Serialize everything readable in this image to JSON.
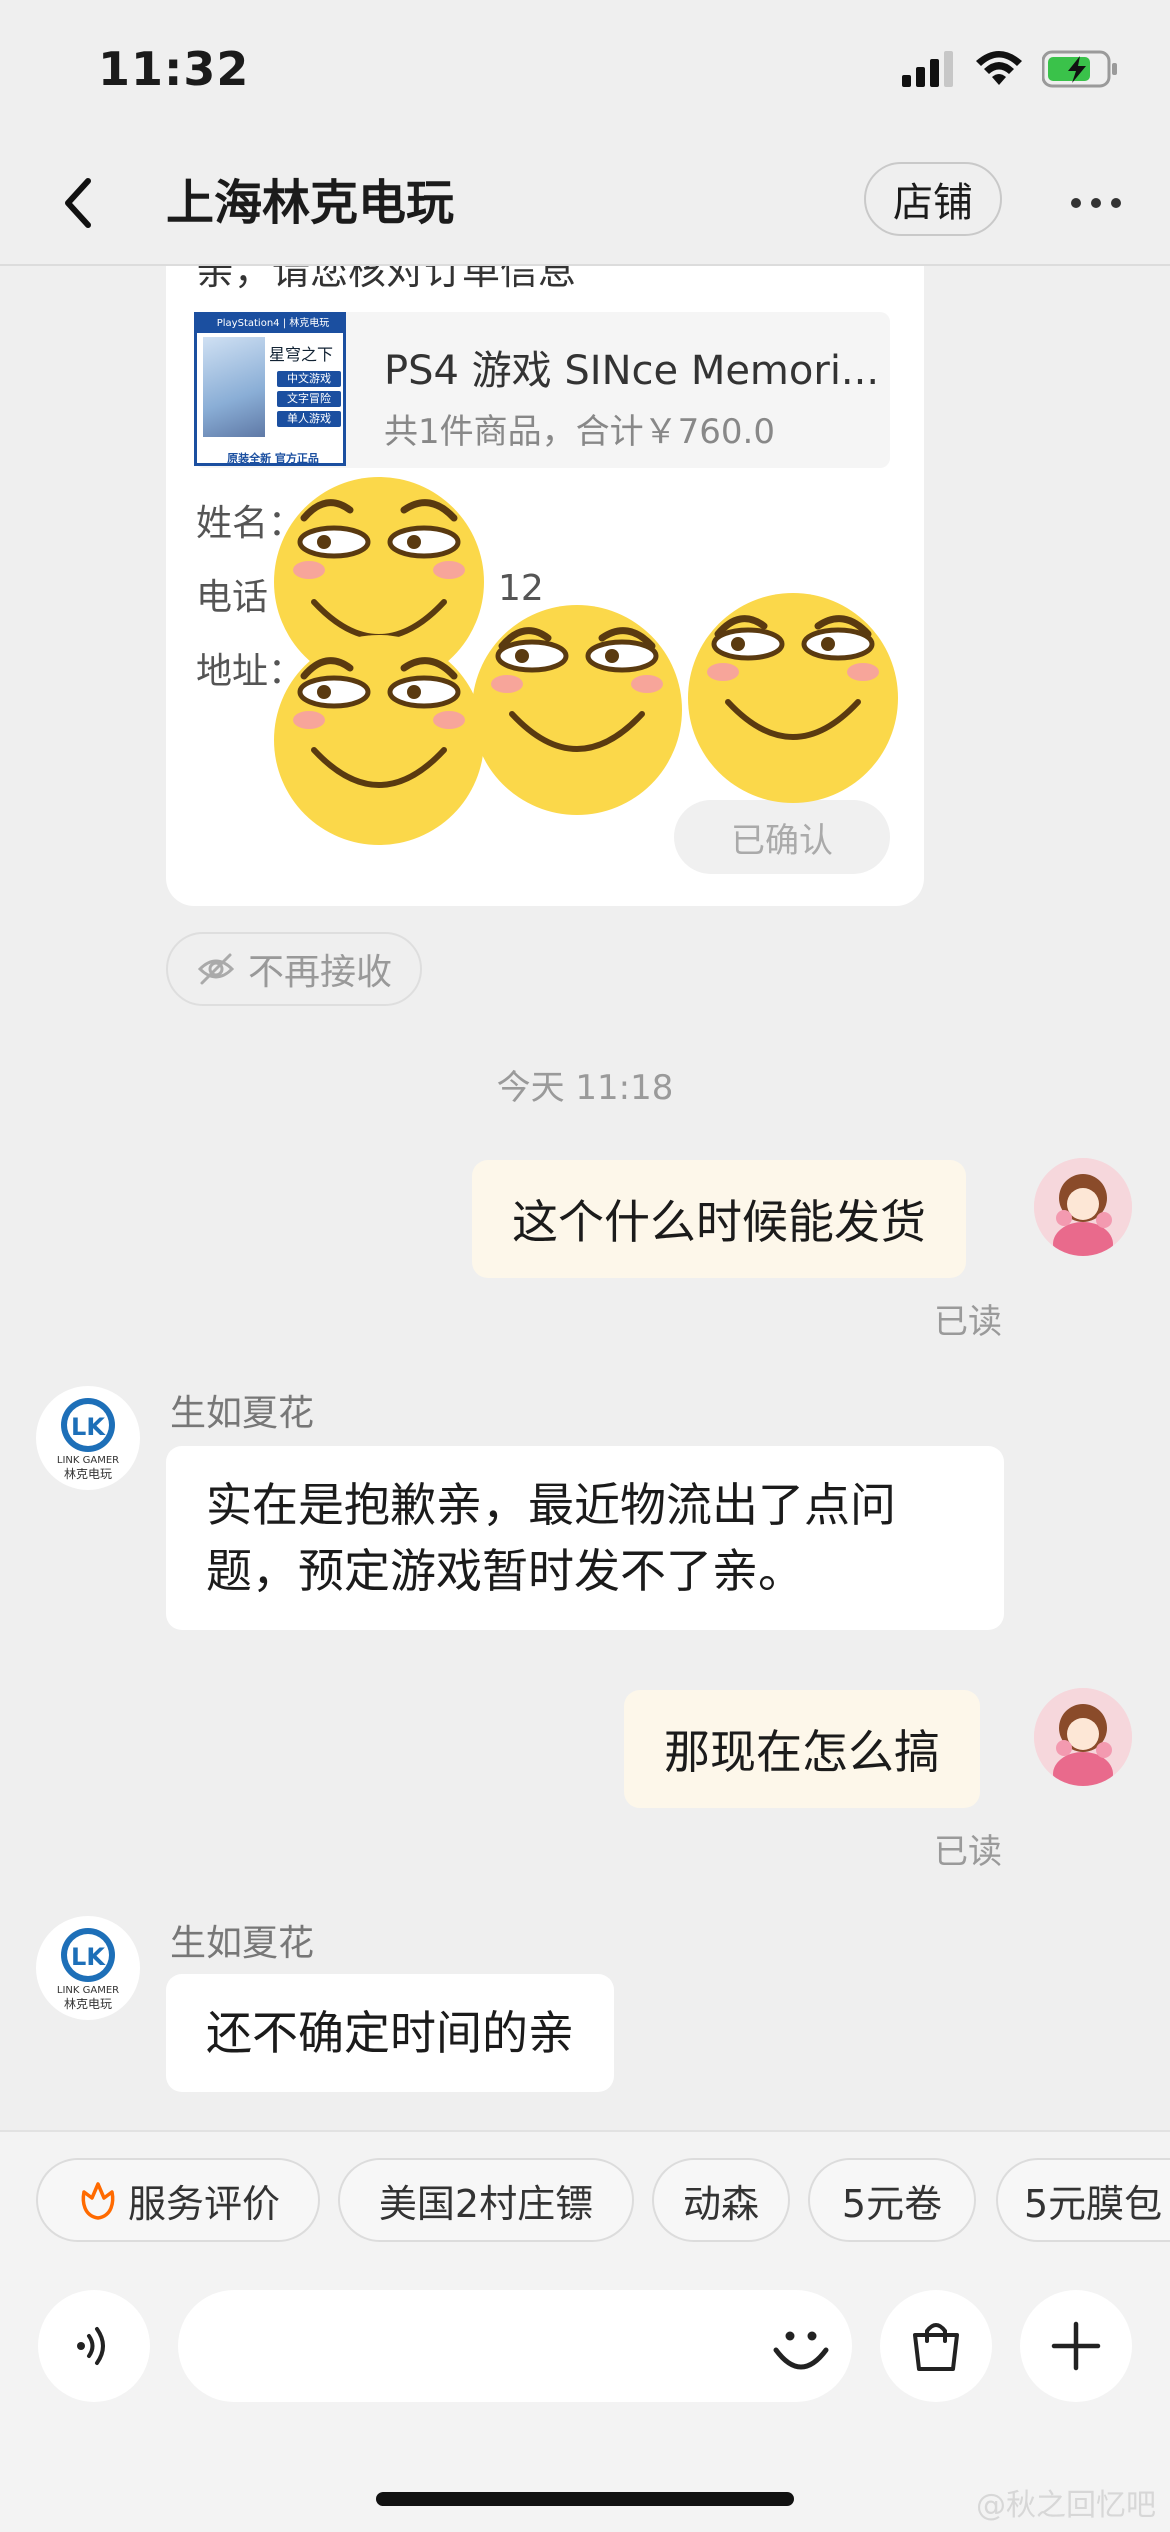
{
  "status_bar": {
    "time": "11:32"
  },
  "nav": {
    "title": "上海林克电玩",
    "shop_label": "店铺"
  },
  "order_card": {
    "prev_line": "亲，请您核对订单信息",
    "product": {
      "name": "PS4 游戏 SINce Memori...",
      "total": "共1件商品，合计￥760.0",
      "thumb_top": "PlayStation4 | 林克电玩",
      "thumb_title": "星穹之下",
      "thumb_tags": [
        "中文游戏",
        "文字冒险",
        "单人游戏"
      ],
      "thumb_bottom": "原装全新 官方正品"
    },
    "labels": {
      "name": "姓名：",
      "phone": "电话",
      "address": "地址："
    },
    "phone_fragment": "12",
    "confirmed_label": "已确认"
  },
  "no_receive_label": "不再接收",
  "time_divider": "今天 11:18",
  "messages": [
    {
      "side": "out",
      "text": "这个什么时候能发货",
      "status": "已读"
    },
    {
      "side": "in",
      "sender": "生如夏花",
      "text": "实在是抱歉亲，最近物流出了点问题，预定游戏暂时发不了亲。"
    },
    {
      "side": "out",
      "text": "那现在怎么搞",
      "status": "已读"
    },
    {
      "side": "in",
      "sender": "生如夏花",
      "text": "还不确定时间的亲"
    }
  ],
  "shop_avatar": {
    "logo": "LK",
    "line1": "LINK GAMER",
    "line2": "林克电玩"
  },
  "quick_replies": [
    "服务评价",
    "美国2村庄镖",
    "动森",
    "5元卷",
    "5元膜包"
  ],
  "watermark": "@秋之回忆吧",
  "icons": {
    "back": "chevron-left-icon",
    "more": "more-dots-icon",
    "voice": "voice-icon",
    "emoji": "emoji-icon",
    "bag": "shopping-bag-icon",
    "add": "plus-icon",
    "service": "flower-icon",
    "no_receive": "eye-off-icon"
  },
  "colors": {
    "background": "#efefef",
    "outgoing_bubble": "#fdf7ea",
    "incoming_bubble": "#ffffff",
    "accent": "#ff6a00",
    "sticker": "#fbd84a"
  }
}
